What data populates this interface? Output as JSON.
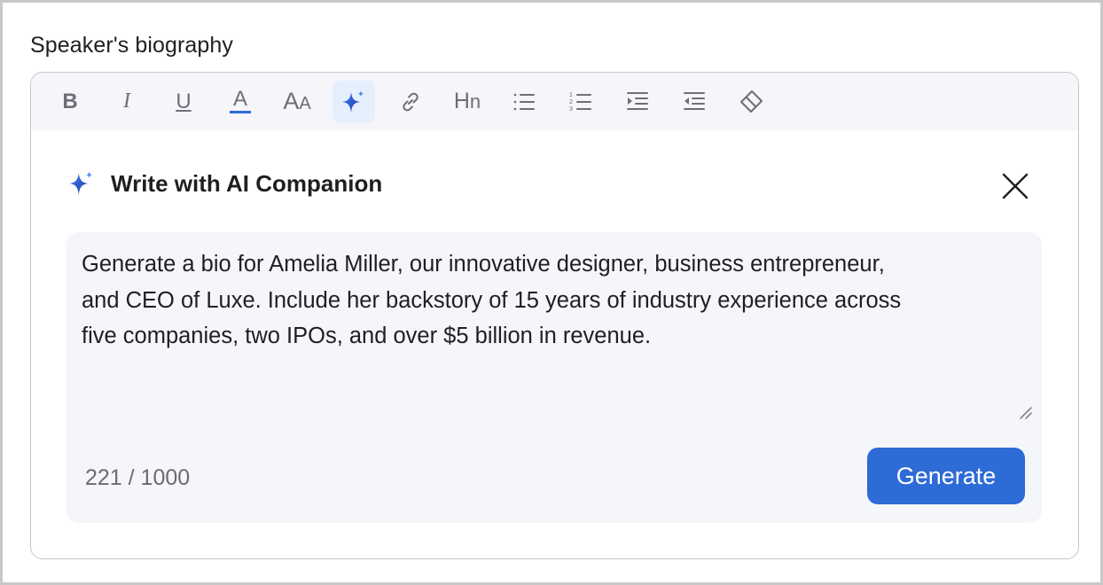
{
  "field": {
    "label": "Speaker's biography"
  },
  "toolbar": {
    "buttons": [
      {
        "name": "bold",
        "icon": "bold-icon",
        "glyph": "B"
      },
      {
        "name": "italic",
        "icon": "italic-icon",
        "glyph": "I"
      },
      {
        "name": "underline",
        "icon": "underline-icon",
        "glyph": "U"
      },
      {
        "name": "text-color",
        "icon": "text-color-icon",
        "glyph": "A"
      },
      {
        "name": "font-size",
        "icon": "font-size-icon",
        "glyph": "AA"
      },
      {
        "name": "ai-companion",
        "icon": "sparkle-icon",
        "active": true
      },
      {
        "name": "link",
        "icon": "link-icon"
      },
      {
        "name": "heading",
        "icon": "heading-icon",
        "glyph": "Hn"
      },
      {
        "name": "bulleted-list",
        "icon": "bulleted-list-icon"
      },
      {
        "name": "numbered-list",
        "icon": "numbered-list-icon"
      },
      {
        "name": "indent",
        "icon": "indent-icon"
      },
      {
        "name": "outdent",
        "icon": "outdent-icon"
      },
      {
        "name": "clear-formatting",
        "icon": "eraser-icon"
      }
    ]
  },
  "ai_panel": {
    "title": "Write with AI Companion",
    "title_icon": "sparkle-icon",
    "close_icon": "close-icon",
    "prompt": {
      "line1": "Generate a bio for Amelia Miller, our innovative designer, business entrepreneur,",
      "line2": "and CEO of Luxe. Include her backstory of 15 years of industry experience across",
      "line3": "five companies, two IPOs, and over $5 billion in revenue."
    },
    "char_count": "221 / 1000",
    "generate_label": "Generate"
  },
  "colors": {
    "accent": "#2d6bd7",
    "toolbar_bg": "#f5f5fa",
    "active_tool_bg": "#e6effd",
    "prompt_bg": "#f5f6f9",
    "text_color_underline": "#2d6bd7"
  }
}
